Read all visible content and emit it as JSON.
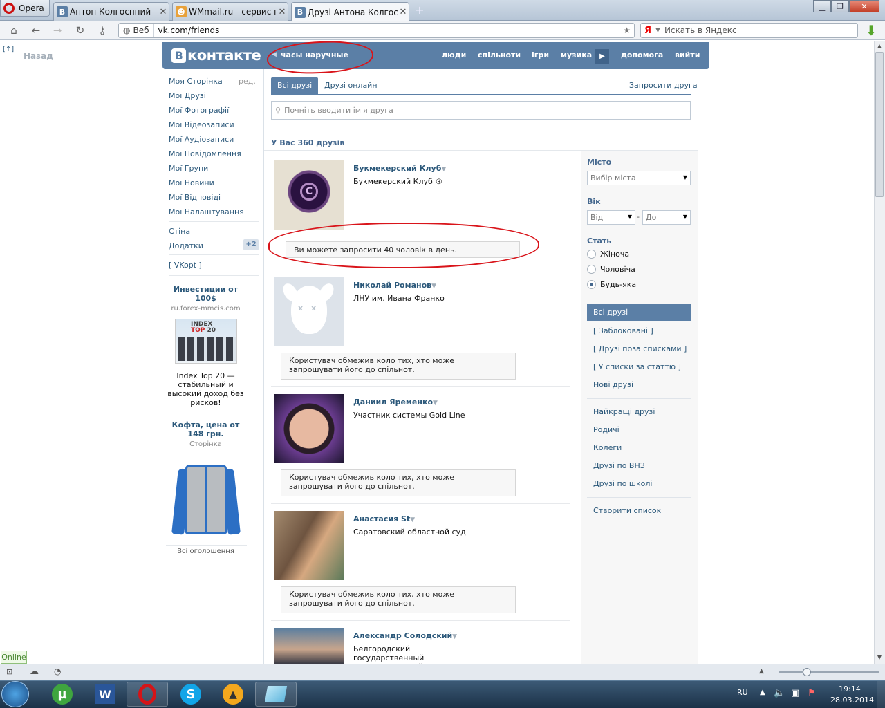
{
  "browser": {
    "opera_label": "Opera",
    "tabs": [
      {
        "title": "Антон Колгоспний",
        "fav": "В",
        "fav_color": "#5b7fa6"
      },
      {
        "title": "WMmail.ru - сервис п...",
        "fav": "☻",
        "fav_color": "#e8a13a"
      },
      {
        "title": "Друзі Антона Колгосп...",
        "fav": "В",
        "fav_color": "#5b7fa6"
      }
    ],
    "address_prefix": "Веб",
    "address": "vk.com/friends",
    "search_placeholder": "Искать в Яндекс",
    "back_label": "Назад",
    "back_marker": "[↑]"
  },
  "vk": {
    "logo": "контакте",
    "logo_letter": "В",
    "status": "часы наручные",
    "nav": [
      "люди",
      "спільноти",
      "ігри",
      "музика",
      "допомога",
      "вийти"
    ],
    "left_menu": [
      "Моя Сторінка",
      "Мої Друзі",
      "Мої Фотографії",
      "Мої Відеозаписи",
      "Мої Аудіозаписи",
      "Мої Повідомлення",
      "Мої Групи",
      "Мої Новини",
      "Мої Відповіді",
      "Мої Налаштування"
    ],
    "edit_label": "ред.",
    "wall": "Стіна",
    "apps": "Додатки",
    "apps_badge": "+2",
    "vkopt": "[ VKopt ]",
    "ads": [
      {
        "title": "Инвестиции от 100$",
        "site": "ru.forex-mmcis.com",
        "text": "Index Top 20 — стабильный и высокий доход без рисков!"
      },
      {
        "title": "Кофта, цена от 148 грн.",
        "site": "Сторінка",
        "text": ""
      }
    ],
    "all_ads": "Всі оголошення"
  },
  "friends": {
    "tabs": [
      "Всі друзі",
      "Друзі онлайн"
    ],
    "invite": "Запросити друга",
    "search_placeholder": "Почніть вводити ім'я друга",
    "count": "У Вас 360 друзів",
    "list": [
      {
        "name": "Букмекерский Клуб",
        "sub": "Букмекерский Клуб ®",
        "note": "Ви можете запросити 40 чоловік в день."
      },
      {
        "name": "Николай Романов",
        "sub": "ЛНУ им. Ивана Франко",
        "note": "Користувач обмежив коло тих, хто може запрошувати його до спільнот."
      },
      {
        "name": "Даниил Яременко",
        "sub": "Участник системы Gold Line",
        "note": "Користувач обмежив коло тих, хто може запрошувати його до спільнот."
      },
      {
        "name": "Анастасия St",
        "sub": "Саратовский областной суд",
        "note": "Користувач обмежив коло тих, хто може запрошувати його до спільнот."
      },
      {
        "name": "Александр Солодский",
        "sub": "Белгородский государственный технологический университет",
        "note": ""
      }
    ]
  },
  "filters": {
    "city_label": "Місто",
    "city_value": "Вибір міста",
    "age_label": "Вік",
    "age_from": "Від",
    "age_to": "До",
    "age_dash": "-",
    "sex_label": "Стать",
    "sex_options": [
      "Жіноча",
      "Чоловіча",
      "Будь-яка"
    ],
    "sex_selected": "Будь-яка",
    "lists_top": [
      "Всі друзі",
      "[ Заблоковані ]",
      "[ Друзі поза списками ]",
      "[ У списки за статтю ]",
      "Нові друзі"
    ],
    "lists_mid": [
      "Найкращі друзі",
      "Родичі",
      "Колеги",
      "Друзі по ВНЗ",
      "Друзі по школі"
    ],
    "create_list": "Створити список"
  },
  "status_bar": {
    "online": "Online"
  },
  "taskbar": {
    "lang": "RU",
    "time": "19:14",
    "date": "28.03.2014"
  }
}
